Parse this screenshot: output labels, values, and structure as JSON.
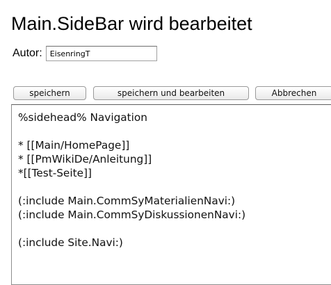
{
  "page": {
    "title": "Main.SideBar wird bearbeitet"
  },
  "author": {
    "label": "Autor:",
    "value": "EisenringT"
  },
  "buttons": {
    "save": "speichern",
    "save_and_edit": "speichern und bearbeiten",
    "cancel": "Abbrechen"
  },
  "editor": {
    "lines": [
      "%sidehead% Navigation",
      "",
      "* [[Main/HomePage]]",
      "* [[PmWikiDe/Anleitung]]",
      "*[[Test-Seite]]",
      "",
      "(:include Main.CommSyMaterialienNavi:)",
      "(:include Main.CommSyDiskussionenNavi:)",
      "",
      "(:include Site.Navi:)"
    ]
  }
}
